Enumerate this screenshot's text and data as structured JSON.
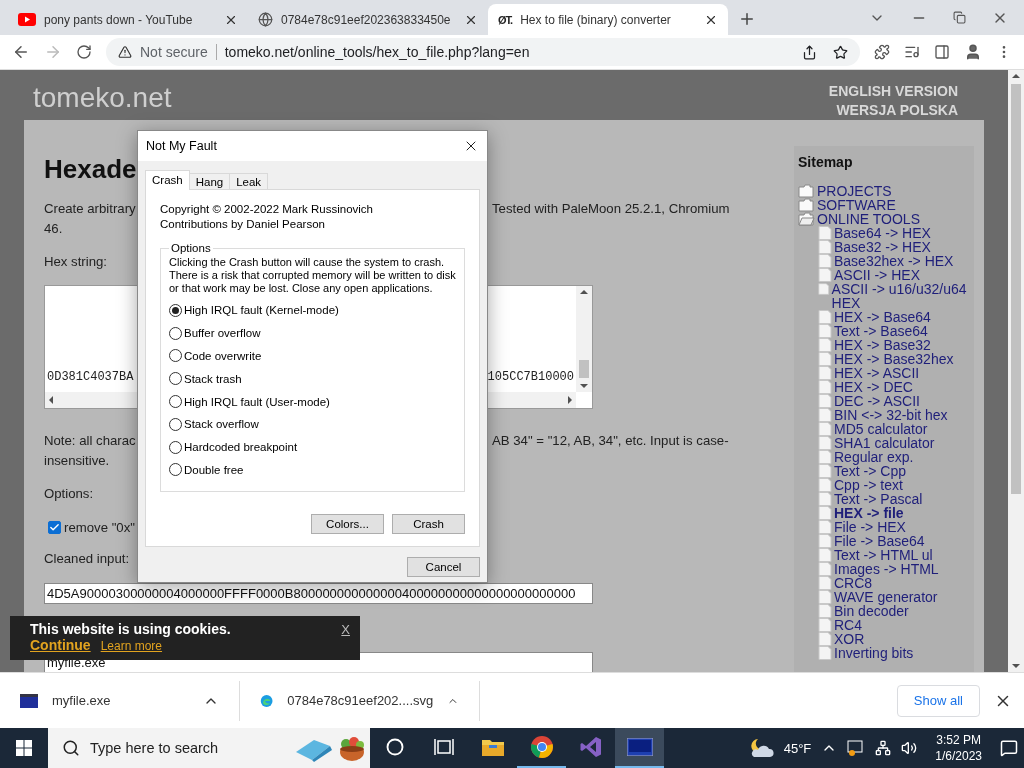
{
  "browser": {
    "tabs": [
      {
        "kind": "youtube",
        "title": "pony pants down - YouTube",
        "selected": false
      },
      {
        "kind": "globe",
        "title": "0784e78c91eef202363833450e",
        "selected": false
      },
      {
        "kind": "site",
        "favicon_text": "ØT.",
        "title": "Hex to file (binary) converter",
        "selected": true
      }
    ],
    "address_bar": {
      "security": "Not secure",
      "url": "tomeko.net/online_tools/hex_to_file.php?lang=en"
    }
  },
  "page": {
    "logo": "tomeko.net",
    "language_links": [
      "ENGLISH VERSION",
      "WERSJA POLSKA"
    ],
    "title": "Hexade",
    "intro": {
      "left": "Create arbitrary",
      "right": "Tested with PaleMoon 25.2.1, Chromium",
      "continuation": "46."
    },
    "hex_label": "Hex string:",
    "hex_field": {
      "left": "0D381C4037BA",
      "right": "105CC7B10000"
    },
    "note": {
      "left": "Note: all charac",
      "right": "AB 34\" = \"12, AB, 34\", etc. Input is case-",
      "continuation": "insensitive."
    },
    "options_label": "Options:",
    "remove_prefix": {
      "label": "remove \"0x\"",
      "checked": true
    },
    "cleaned_label": "Cleaned input:",
    "cleaned_value": "4D5A90000300000004000000FFFF0000B800000000000000400000000000000000000000",
    "filename_value": "myfile.exe"
  },
  "sitemap": {
    "title": "Sitemap",
    "items": [
      {
        "label": "PROJECTS",
        "expanded": false
      },
      {
        "label": "SOFTWARE",
        "expanded": false
      },
      {
        "label": "ONLINE TOOLS",
        "expanded": true,
        "children": [
          {
            "label": "Base64 -> HEX",
            "selected": false
          },
          {
            "label": "Base32 -> HEX",
            "selected": false
          },
          {
            "label": "Base32hex -> HEX",
            "selected": false
          },
          {
            "label": "ASCII -> HEX",
            "selected": false
          },
          {
            "label": "ASCII -> u16/u32/u64 HEX",
            "selected": false
          },
          {
            "label": "HEX -> Base64",
            "selected": false
          },
          {
            "label": "Text -> Base64",
            "selected": false
          },
          {
            "label": "HEX -> Base32",
            "selected": false
          },
          {
            "label": "HEX -> Base32hex",
            "selected": false
          },
          {
            "label": "HEX -> ASCII",
            "selected": false
          },
          {
            "label": "HEX -> DEC",
            "selected": false
          },
          {
            "label": "DEC -> ASCII",
            "selected": false
          },
          {
            "label": "BIN <-> 32-bit hex",
            "selected": false
          },
          {
            "label": "MD5 calculator",
            "selected": false
          },
          {
            "label": "SHA1 calculator",
            "selected": false
          },
          {
            "label": "Regular exp.",
            "selected": false
          },
          {
            "label": "Text -> Cpp",
            "selected": false
          },
          {
            "label": "Cpp -> text",
            "selected": false
          },
          {
            "label": "Text -> Pascal",
            "selected": false
          },
          {
            "label": "HEX -> file",
            "selected": true
          },
          {
            "label": "File -> HEX",
            "selected": false
          },
          {
            "label": "File -> Base64",
            "selected": false
          },
          {
            "label": "Text -> HTML ul",
            "selected": false
          },
          {
            "label": "Images -> HTML",
            "selected": false
          },
          {
            "label": "CRC8",
            "selected": false
          },
          {
            "label": "WAVE generator",
            "selected": false
          },
          {
            "label": "Bin decoder",
            "selected": false
          },
          {
            "label": "RC4",
            "selected": false
          },
          {
            "label": "XOR",
            "selected": false
          },
          {
            "label": "Inverting bits",
            "selected": false
          }
        ]
      }
    ]
  },
  "dialog": {
    "title": "Not My Fault",
    "tabs": [
      {
        "label": "Crash",
        "selected": true
      },
      {
        "label": "Hang",
        "selected": false
      },
      {
        "label": "Leak",
        "selected": false
      }
    ],
    "credits": [
      "Copyright © 2002-2022 Mark Russinovich",
      "Contributions by Daniel Pearson"
    ],
    "group_label": "Options",
    "warning": "Clicking the Crash button will cause the system to crash. There is a risk that corrupted memory will be written to disk or that work may be lost. Close any open applications.",
    "options": [
      {
        "label": "High IRQL fault (Kernel-mode)",
        "selected": true
      },
      {
        "label": "Buffer overflow",
        "selected": false
      },
      {
        "label": "Code overwrite",
        "selected": false
      },
      {
        "label": "Stack trash",
        "selected": false
      },
      {
        "label": "High IRQL fault (User-mode)",
        "selected": false
      },
      {
        "label": "Stack overflow",
        "selected": false
      },
      {
        "label": "Hardcoded breakpoint",
        "selected": false
      },
      {
        "label": "Double free",
        "selected": false
      }
    ],
    "buttons": [
      "Colors...",
      "Crash"
    ],
    "cancel": "Cancel"
  },
  "cookie_banner": {
    "message": "This website is using cookies.",
    "accept": "Continue",
    "learn_more": "Learn more",
    "close": "X"
  },
  "downloads": {
    "items": [
      {
        "kind": "app",
        "name": "myfile.exe"
      },
      {
        "kind": "edge",
        "name": "0784e78c91eef202....svg"
      }
    ],
    "show_all": "Show all"
  },
  "taskbar": {
    "search_placeholder": "Type here to search",
    "apps": [
      {
        "kind": "cortana",
        "running": false,
        "selected": false
      },
      {
        "kind": "taskview",
        "running": false,
        "selected": false
      },
      {
        "kind": "explorer",
        "running": false,
        "selected": false
      },
      {
        "kind": "chrome",
        "running": true,
        "selected": false
      },
      {
        "kind": "visualstudio",
        "running": false,
        "selected": false
      },
      {
        "kind": "app",
        "running": true,
        "selected": true
      }
    ],
    "weather": "45°F",
    "time": "3:52 PM",
    "date": "1/6/2023"
  }
}
